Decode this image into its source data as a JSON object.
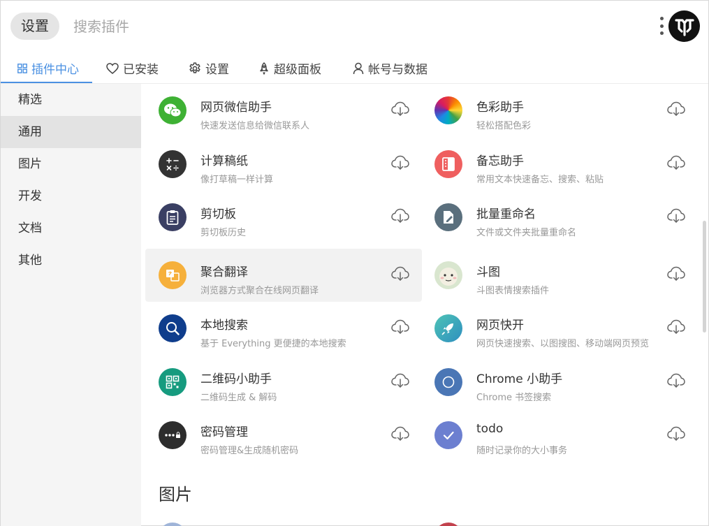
{
  "header": {
    "tag_label": "设置",
    "search_placeholder": "搜索插件",
    "more_icon": "more-vertical-icon",
    "avatar_icon": "app-logo"
  },
  "tabs": [
    {
      "label": "插件中心",
      "icon": "grid-icon",
      "active": true
    },
    {
      "label": "已安装",
      "icon": "heart-icon"
    },
    {
      "label": "设置",
      "icon": "gear-icon"
    },
    {
      "label": "超级面板",
      "icon": "rocket-icon"
    },
    {
      "label": "帐号与数据",
      "icon": "user-icon"
    }
  ],
  "sidebar": {
    "items": [
      {
        "label": "精选"
      },
      {
        "label": "通用",
        "active": true
      },
      {
        "label": "图片"
      },
      {
        "label": "开发"
      },
      {
        "label": "文档"
      },
      {
        "label": "其他"
      }
    ]
  },
  "plugins": [
    {
      "name": "网页微信助手",
      "desc": "快速发送信息给微信联系人",
      "icon": "wechat-icon",
      "color": "#3eb134"
    },
    {
      "name": "色彩助手",
      "desc": "轻松搭配色彩",
      "icon": "color-wheel-icon",
      "color": "#e53935"
    },
    {
      "name": "计算稿纸",
      "desc": "像打草稿一样计算",
      "icon": "calculator-icon",
      "color": "#333333"
    },
    {
      "name": "备忘助手",
      "desc": "常用文本快速备忘、搜索、粘贴",
      "icon": "memo-icon",
      "color": "#ef5f5f"
    },
    {
      "name": "剪切板",
      "desc": "剪切板历史",
      "icon": "clipboard-icon",
      "color": "#3a3f63"
    },
    {
      "name": "批量重命名",
      "desc": "文件或文件夹批量重命名",
      "icon": "rename-icon",
      "color": "#5a6f7d"
    },
    {
      "name": "聚合翻译",
      "desc": "浏览器方式聚合在线网页翻译",
      "icon": "translate-icon",
      "color": "#f6b03b",
      "hover": true
    },
    {
      "name": "斗图",
      "desc": "斗图表情搜索插件",
      "icon": "meme-icon",
      "color": "#d9e6cf"
    },
    {
      "name": "本地搜索",
      "desc": "基于 Everything 更便捷的本地搜索",
      "icon": "search-icon",
      "color": "#0f3d8c"
    },
    {
      "name": "网页快开",
      "desc": "网页快速搜索、以图搜图、移动端网页预览",
      "icon": "rocket-icon",
      "color": "#3ab0b8"
    },
    {
      "name": "二维码小助手",
      "desc": "二维码生成 & 解码",
      "icon": "qrcode-icon",
      "color": "#169b7f"
    },
    {
      "name": "Chrome 小助手",
      "desc": "Chrome 书签搜索",
      "icon": "chrome-icon",
      "color": "#4a76b5"
    },
    {
      "name": "密码管理",
      "desc": "密码管理&生成随机密码",
      "icon": "password-icon",
      "color": "#2d2d2d"
    },
    {
      "name": "todo",
      "desc": "随时记录你的大小事务",
      "icon": "check-icon",
      "color": "#6c7fd0"
    }
  ],
  "section": {
    "title": "图片"
  },
  "download_icon": "cloud-download-icon"
}
